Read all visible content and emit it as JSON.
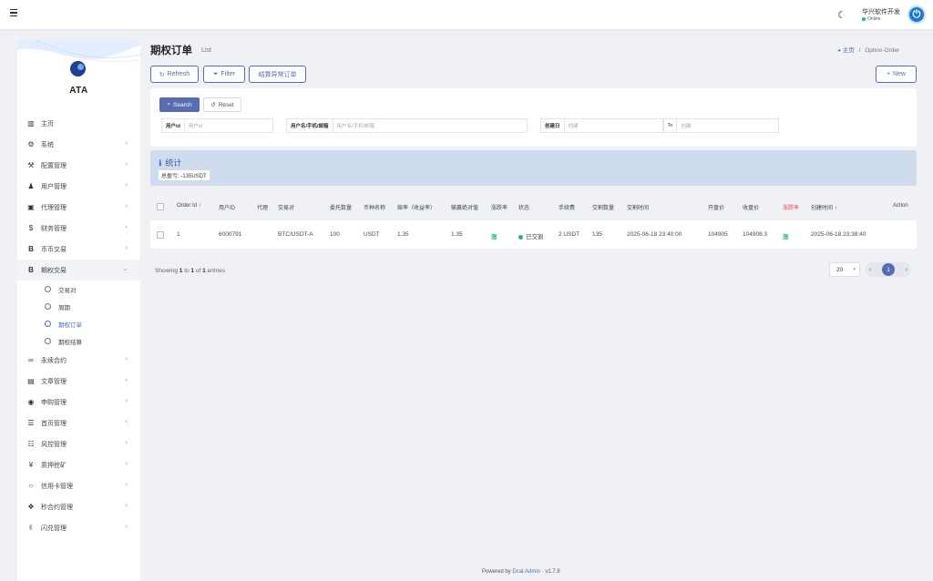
{
  "topbar": {
    "menu_icon": "hamburger-icon",
    "theme_icon": "moon-icon",
    "user_name": "华兴软件开发",
    "user_status": "Online",
    "avatar_icon": "power-icon"
  },
  "sidebar": {
    "logo_text": "ATA",
    "items": [
      {
        "icon": "bar-chart-icon",
        "glyph": "▥",
        "label": "主页",
        "chevron": false
      },
      {
        "icon": "gear-icon",
        "glyph": "⚙",
        "label": "系统",
        "chevron": true
      },
      {
        "icon": "wrench-icon",
        "glyph": "🔧",
        "label": "配置管理",
        "chevron": true
      },
      {
        "icon": "users-icon",
        "glyph": "👥",
        "label": "用户管理",
        "chevron": true
      },
      {
        "icon": "id-card-icon",
        "glyph": "▣",
        "label": "代理管理",
        "chevron": true
      },
      {
        "icon": "dollar-icon",
        "glyph": "$",
        "label": "财务管理",
        "chevron": true
      },
      {
        "icon": "bitcoin-icon",
        "glyph": "B",
        "label": "币币交易",
        "chevron": true
      },
      {
        "icon": "bitcoin-icon",
        "glyph": "B",
        "label": "期权交易",
        "chevron": true,
        "open": true
      }
    ],
    "sub_items": [
      {
        "label": "交易对",
        "active": false
      },
      {
        "label": "周期",
        "active": false
      },
      {
        "label": "期权订单",
        "active": true
      },
      {
        "label": "期权结算",
        "active": false
      }
    ],
    "items_after": [
      {
        "icon": "link-icon",
        "glyph": "🔗",
        "label": "永续合约",
        "chevron": true
      },
      {
        "icon": "newspaper-icon",
        "glyph": "▤",
        "label": "文章管理",
        "chevron": true
      },
      {
        "icon": "lifebuoy-icon",
        "glyph": "◉",
        "label": "申购管理",
        "chevron": true
      },
      {
        "icon": "list-icon",
        "glyph": "☰",
        "label": "首页管理",
        "chevron": true
      },
      {
        "icon": "list-alt-icon",
        "glyph": "☷",
        "label": "风控管理",
        "chevron": true
      },
      {
        "icon": "yen-icon",
        "glyph": "¥",
        "label": "质押挖矿",
        "chevron": true
      },
      {
        "icon": "circle-icon",
        "glyph": "○",
        "label": "信用卡管理",
        "chevron": true
      },
      {
        "icon": "cubes-icon",
        "glyph": "❖",
        "label": "秒合约管理",
        "chevron": true
      },
      {
        "icon": "handshake-icon",
        "glyph": "✌",
        "label": "闪兑管理",
        "chevron": true
      }
    ]
  },
  "header": {
    "title": "期权订单",
    "subtitle": "List",
    "breadcrumb_home": "主页",
    "breadcrumb_sep": "/",
    "breadcrumb_current": "Option-Order"
  },
  "toolbar": {
    "refresh": "Refresh",
    "filter": "Filter",
    "settle_abnormal": "结算异常订单",
    "new": "New"
  },
  "filter": {
    "search": "Search",
    "reset": "Reset",
    "fields": [
      {
        "label": "用户id",
        "placeholder": "用户id"
      },
      {
        "label": "用户名/手机/邮箱",
        "placeholder": "用户名/手机/邮箱"
      },
      {
        "label": "创建日",
        "placeholder": "创建"
      },
      {
        "label": "To",
        "placeholder": "创建"
      }
    ]
  },
  "stats": {
    "title": "统计",
    "total": "总盈亏: -135USDT"
  },
  "table": {
    "columns": [
      "Order Id",
      "用户ID",
      "代理",
      "交易对",
      "委托数量",
      "币种名称",
      "赔率（收益率）",
      "输赢绝对值",
      "涨跌率",
      "状态",
      "手续费",
      "交割数量",
      "交割时间",
      "开盘价",
      "收盘价",
      "涨跌率",
      "创建时间",
      "Action"
    ],
    "rows": [
      {
        "order_id": "1",
        "user_id": "6000791",
        "agent": "",
        "pair": "BTC/USDT-A",
        "qty": "100",
        "coin": "USDT",
        "odds": "1.35",
        "abs_pl": "1.35",
        "trend": "涨",
        "status": "已交割",
        "fee": "2 USDT",
        "delivered_qty": "135",
        "delivery_time": "2025-06-18 23:40:00",
        "open_price": "104905",
        "close_price": "104908.3",
        "trend2": "涨",
        "created_at": "2025-06-18 23:38:40"
      }
    ]
  },
  "pagination": {
    "showing_prefix": "Showing",
    "from": "1",
    "to_word": "to",
    "to": "1",
    "of_word": "of",
    "total": "1",
    "suffix": "entries",
    "per_page": "20",
    "prev": "‹",
    "current": "1",
    "next": "›"
  },
  "footer": {
    "powered_by": "Powered by",
    "brand": "Dcat Admin",
    "sep": "·",
    "version": "v1.7.8"
  },
  "colors": {
    "primary": "#586cb1",
    "success": "#21b978",
    "stats_bg": "#cfdcee"
  }
}
